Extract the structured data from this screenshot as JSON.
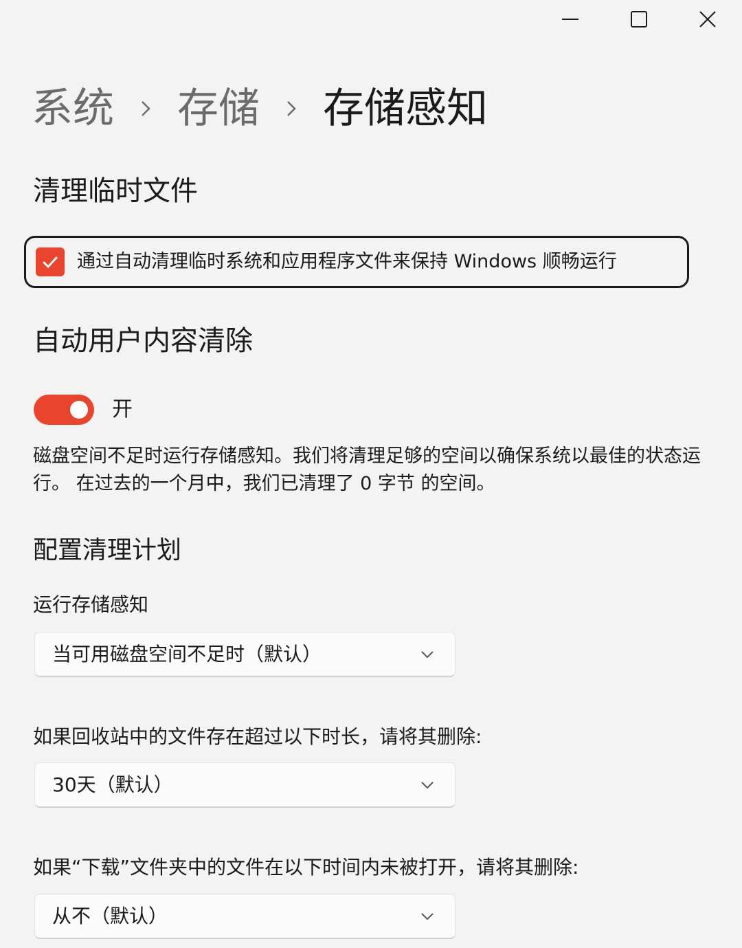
{
  "breadcrumb": {
    "items": [
      "系统",
      "存储"
    ],
    "current": "存储感知"
  },
  "temp_files": {
    "title": "清理临时文件",
    "checkbox_label": "通过自动清理临时系统和应用程序文件来保持 Windows 顺畅运行",
    "checked": true
  },
  "auto_cleanup": {
    "title": "自动用户内容清除",
    "toggle_state": "开",
    "toggle_on": true,
    "description": "磁盘空间不足时运行存储感知。我们将清理足够的空间以确保系统以最佳的状态运行。 在过去的一个月中，我们已清理了 0 字节 的空间。"
  },
  "schedule": {
    "title": "配置清理计划",
    "run_label": "运行存储感知",
    "run_value": "当可用磁盘空间不足时（默认）",
    "recycle_label": "如果回收站中的文件存在超过以下时长，请将其删除:",
    "recycle_value": "30天（默认）",
    "downloads_label": "如果“下载”文件夹中的文件在以下时间内未被打开，请将其删除:",
    "downloads_value": "从不（默认）"
  },
  "colors": {
    "accent": "#e8452c",
    "background": "#f3f3f3"
  },
  "icons": {
    "minimize": "minimize-icon",
    "maximize": "maximize-icon",
    "close": "close-icon",
    "chevron": "chevron-down-icon",
    "separator": "chevron-right-icon",
    "check": "checkmark-icon"
  }
}
